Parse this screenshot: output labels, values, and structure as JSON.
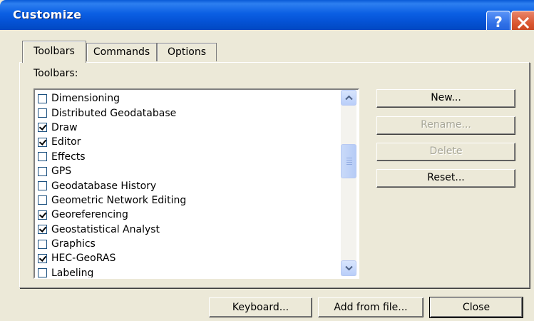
{
  "window": {
    "title": "Customize",
    "help_glyph": "?"
  },
  "tabs": [
    {
      "label": "Toolbars",
      "active": true
    },
    {
      "label": "Commands",
      "active": false
    },
    {
      "label": "Options",
      "active": false
    }
  ],
  "toolbars_label": "Toolbars:",
  "toolbar_items": [
    {
      "label": "Dimensioning",
      "checked": false
    },
    {
      "label": "Distributed Geodatabase",
      "checked": false
    },
    {
      "label": "Draw",
      "checked": true
    },
    {
      "label": "Editor",
      "checked": true
    },
    {
      "label": "Effects",
      "checked": false
    },
    {
      "label": "GPS",
      "checked": false
    },
    {
      "label": "Geodatabase History",
      "checked": false
    },
    {
      "label": "Geometric Network Editing",
      "checked": false
    },
    {
      "label": "Georeferencing",
      "checked": true
    },
    {
      "label": "Geostatistical Analyst",
      "checked": true
    },
    {
      "label": "Graphics",
      "checked": false
    },
    {
      "label": "HEC-GeoRAS",
      "checked": true
    },
    {
      "label": "Labeling",
      "checked": false
    }
  ],
  "side_buttons": {
    "new": "New...",
    "rename": "Rename...",
    "delete": "Delete",
    "reset": "Reset..."
  },
  "bottom_buttons": {
    "keyboard": "Keyboard...",
    "add_from_file": "Add from file...",
    "close": "Close"
  },
  "icons": {
    "help": "help-icon",
    "close": "close-x-icon",
    "scroll_up": "chevron-up-icon",
    "scroll_down": "chevron-down-icon"
  },
  "colors": {
    "titlebar": "#0553d6",
    "window_bg": "#ece9d8",
    "close_button": "#d9552f",
    "disabled_text": "#a7a697"
  }
}
